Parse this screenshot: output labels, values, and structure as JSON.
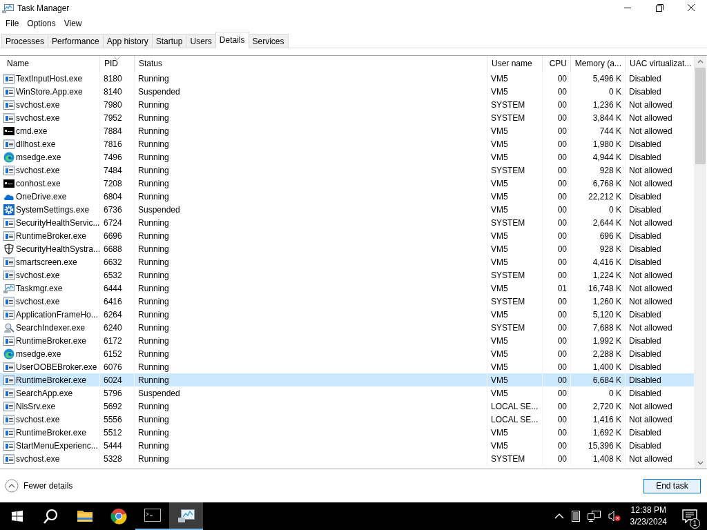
{
  "window": {
    "title": "Task Manager"
  },
  "menu": [
    "File",
    "Options",
    "View"
  ],
  "tabs": [
    {
      "label": "Processes",
      "selected": false
    },
    {
      "label": "Performance",
      "selected": false
    },
    {
      "label": "App history",
      "selected": false
    },
    {
      "label": "Startup",
      "selected": false
    },
    {
      "label": "Users",
      "selected": false
    },
    {
      "label": "Details",
      "selected": true
    },
    {
      "label": "Services",
      "selected": false
    }
  ],
  "table": {
    "columns": [
      {
        "label": "Name",
        "kind": "text",
        "sorted": false
      },
      {
        "label": "PID",
        "kind": "text",
        "sorted": true
      },
      {
        "label": "Status",
        "kind": "text",
        "sorted": false
      },
      {
        "label": "User name",
        "kind": "text",
        "sorted": false
      },
      {
        "label": "CPU",
        "kind": "number",
        "sorted": false
      },
      {
        "label": "Memory (a...",
        "kind": "number",
        "sorted": false
      },
      {
        "label": "UAC virtualizat...",
        "kind": "text",
        "sorted": false
      }
    ],
    "rows": [
      {
        "kind": "app",
        "cells": [
          "TextInputHost.exe",
          "8180",
          "Running",
          "VM5",
          "00",
          "5,496 K",
          "Disabled"
        ],
        "selected": false
      },
      {
        "kind": "app",
        "cells": [
          "WinStore.App.exe",
          "8140",
          "Suspended",
          "VM5",
          "00",
          "0 K",
          "Disabled"
        ],
        "selected": false
      },
      {
        "kind": "app",
        "cells": [
          "svchost.exe",
          "7980",
          "Running",
          "SYSTEM",
          "00",
          "1,236 K",
          "Not allowed"
        ],
        "selected": false
      },
      {
        "kind": "app",
        "cells": [
          "svchost.exe",
          "7952",
          "Running",
          "SYSTEM",
          "00",
          "3,844 K",
          "Not allowed"
        ],
        "selected": false
      },
      {
        "kind": "console",
        "cells": [
          "cmd.exe",
          "7884",
          "Running",
          "VM5",
          "00",
          "744 K",
          "Not allowed"
        ],
        "selected": false
      },
      {
        "kind": "app",
        "cells": [
          "dllhost.exe",
          "7816",
          "Running",
          "VM5",
          "00",
          "1,980 K",
          "Disabled"
        ],
        "selected": false
      },
      {
        "kind": "edge",
        "cells": [
          "msedge.exe",
          "7496",
          "Running",
          "VM5",
          "00",
          "4,944 K",
          "Disabled"
        ],
        "selected": false
      },
      {
        "kind": "app",
        "cells": [
          "svchost.exe",
          "7484",
          "Running",
          "SYSTEM",
          "00",
          "928 K",
          "Not allowed"
        ],
        "selected": false
      },
      {
        "kind": "console",
        "cells": [
          "conhost.exe",
          "7208",
          "Running",
          "VM5",
          "00",
          "6,768 K",
          "Not allowed"
        ],
        "selected": false
      },
      {
        "kind": "cloud",
        "cells": [
          "OneDrive.exe",
          "6804",
          "Running",
          "VM5",
          "00",
          "22,212 K",
          "Disabled"
        ],
        "selected": false
      },
      {
        "kind": "gear",
        "cells": [
          "SystemSettings.exe",
          "6736",
          "Suspended",
          "VM5",
          "00",
          "0 K",
          "Disabled"
        ],
        "selected": false
      },
      {
        "kind": "app",
        "cells": [
          "SecurityHealthServic...",
          "6724",
          "Running",
          "SYSTEM",
          "00",
          "2,644 K",
          "Not allowed"
        ],
        "selected": false
      },
      {
        "kind": "app",
        "cells": [
          "RuntimeBroker.exe",
          "6696",
          "Running",
          "VM5",
          "00",
          "696 K",
          "Disabled"
        ],
        "selected": false
      },
      {
        "kind": "shield",
        "cells": [
          "SecurityHealthSystra...",
          "6688",
          "Running",
          "VM5",
          "00",
          "928 K",
          "Disabled"
        ],
        "selected": false
      },
      {
        "kind": "app",
        "cells": [
          "smartscreen.exe",
          "6632",
          "Running",
          "VM5",
          "00",
          "4,416 K",
          "Disabled"
        ],
        "selected": false
      },
      {
        "kind": "app",
        "cells": [
          "svchost.exe",
          "6532",
          "Running",
          "SYSTEM",
          "00",
          "1,224 K",
          "Not allowed"
        ],
        "selected": false
      },
      {
        "kind": "monitor",
        "cells": [
          "Taskmgr.exe",
          "6444",
          "Running",
          "VM5",
          "01",
          "16,748 K",
          "Not allowed"
        ],
        "selected": false
      },
      {
        "kind": "app",
        "cells": [
          "svchost.exe",
          "6416",
          "Running",
          "SYSTEM",
          "00",
          "1,260 K",
          "Not allowed"
        ],
        "selected": false
      },
      {
        "kind": "app",
        "cells": [
          "ApplicationFrameHo...",
          "6264",
          "Running",
          "VM5",
          "00",
          "5,120 K",
          "Disabled"
        ],
        "selected": false
      },
      {
        "kind": "indexer",
        "cells": [
          "SearchIndexer.exe",
          "6240",
          "Running",
          "SYSTEM",
          "00",
          "7,688 K",
          "Not allowed"
        ],
        "selected": false
      },
      {
        "kind": "app",
        "cells": [
          "RuntimeBroker.exe",
          "6172",
          "Running",
          "VM5",
          "00",
          "1,992 K",
          "Disabled"
        ],
        "selected": false
      },
      {
        "kind": "edge",
        "cells": [
          "msedge.exe",
          "6152",
          "Running",
          "VM5",
          "00",
          "2,288 K",
          "Disabled"
        ],
        "selected": false
      },
      {
        "kind": "app",
        "cells": [
          "UserOOBEBroker.exe",
          "6076",
          "Running",
          "VM5",
          "00",
          "1,400 K",
          "Disabled"
        ],
        "selected": false
      },
      {
        "kind": "app",
        "cells": [
          "RuntimeBroker.exe",
          "6024",
          "Running",
          "VM5",
          "00",
          "6,684 K",
          "Disabled"
        ],
        "selected": true
      },
      {
        "kind": "app",
        "cells": [
          "SearchApp.exe",
          "5796",
          "Suspended",
          "VM5",
          "00",
          "0 K",
          "Disabled"
        ],
        "selected": false
      },
      {
        "kind": "app",
        "cells": [
          "NisSrv.exe",
          "5692",
          "Running",
          "LOCAL SE...",
          "00",
          "2,720 K",
          "Not allowed"
        ],
        "selected": false
      },
      {
        "kind": "app",
        "cells": [
          "svchost.exe",
          "5556",
          "Running",
          "LOCAL SE...",
          "00",
          "1,416 K",
          "Not allowed"
        ],
        "selected": false
      },
      {
        "kind": "app",
        "cells": [
          "RuntimeBroker.exe",
          "5512",
          "Running",
          "VM5",
          "00",
          "1,692 K",
          "Disabled"
        ],
        "selected": false
      },
      {
        "kind": "app",
        "cells": [
          "StartMenuExperienc...",
          "5444",
          "Running",
          "VM5",
          "00",
          "15,396 K",
          "Disabled"
        ],
        "selected": false
      },
      {
        "kind": "app",
        "cells": [
          "svchost.exe",
          "5328",
          "Running",
          "SYSTEM",
          "00",
          "1,408 K",
          "Not allowed"
        ],
        "selected": false
      }
    ]
  },
  "footer": {
    "toggle": "Fewer details",
    "button": "End task"
  },
  "taskbar": {
    "apps": [
      {
        "kind": "start",
        "running": false,
        "active": false
      },
      {
        "kind": "search",
        "running": false,
        "active": false
      },
      {
        "kind": "folder",
        "running": false,
        "active": false
      },
      {
        "kind": "chrome",
        "running": false,
        "active": false
      },
      {
        "kind": "console",
        "running": true,
        "active": false
      },
      {
        "kind": "monitor",
        "running": true,
        "active": true
      }
    ],
    "time": "12:38 PM",
    "date": "3/23/2024",
    "notifications": "1"
  }
}
